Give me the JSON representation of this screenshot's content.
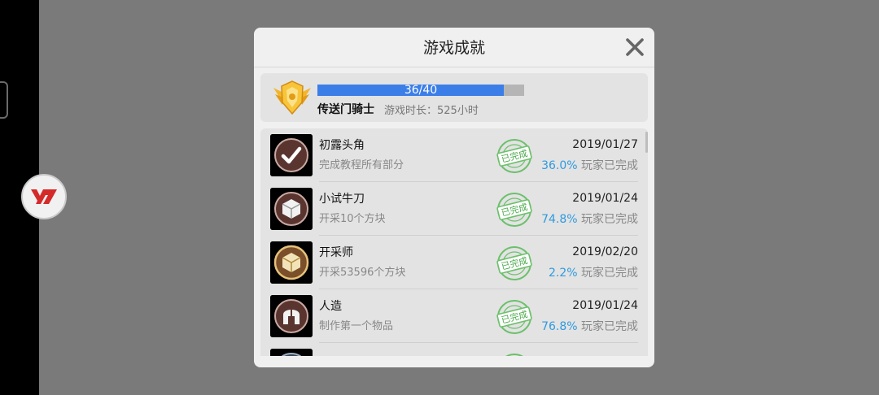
{
  "dialog": {
    "title": "游戏成就",
    "close_icon": "close-icon"
  },
  "rank": {
    "emblem_icon": "gold-shield-wings-emblem",
    "progress_text": "36/40",
    "progress_value": 0.9,
    "name": "传送门骑士",
    "playtime": "游戏时长：525小时"
  },
  "achievements": [
    {
      "name": "初露头角",
      "desc": "完成教程所有部分",
      "stamp": "已完成",
      "date": "2019/01/27",
      "rate": "36.0%",
      "rate_suffix": " 玩家已完成",
      "icon": "checkmark-badge-icon"
    },
    {
      "name": "小试牛刀",
      "desc": "开采10个方块",
      "stamp": "已完成",
      "date": "2019/01/24",
      "rate": "74.8%",
      "rate_suffix": " 玩家已完成",
      "icon": "cube-badge-icon"
    },
    {
      "name": "开采师",
      "desc": "开采53596个方块",
      "stamp": "已完成",
      "date": "2019/02/20",
      "rate": "2.2%",
      "rate_suffix": " 玩家已完成",
      "icon": "gold-cube-badge-icon"
    },
    {
      "name": "人造",
      "desc": "制作第一个物品",
      "stamp": "已完成",
      "date": "2019/01/24",
      "rate": "76.8%",
      "rate_suffix": " 玩家已完成",
      "icon": "helmet-badge-icon"
    }
  ],
  "colors": {
    "progress_fill": "#3b7ee8",
    "percent_text": "#2e9ae0",
    "stamp_green": "#5cb85c",
    "badge_brown": "#5a3530"
  },
  "side_logo": "y7-logo-icon"
}
